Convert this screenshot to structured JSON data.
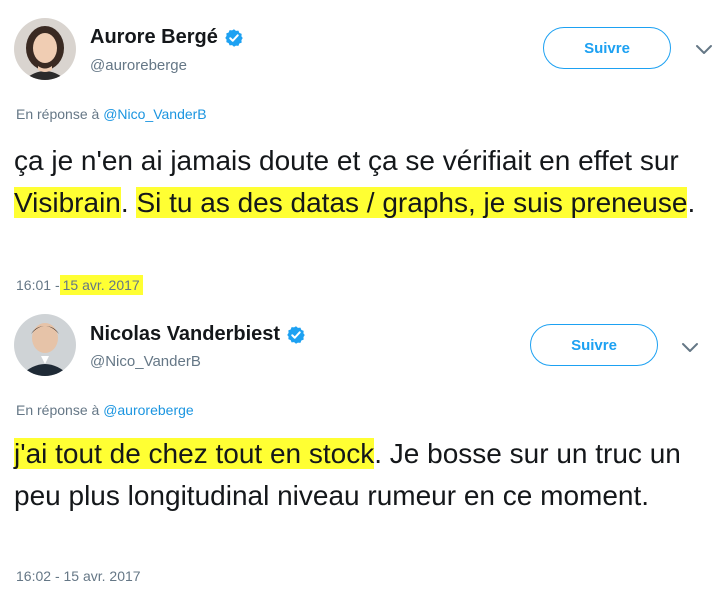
{
  "tweets": [
    {
      "author_name": "Aurore Bergé",
      "handle": "@auroreberge",
      "follow_label": "Suivre",
      "reply_prefix": "En réponse à",
      "reply_to": "@Nico_VanderB",
      "text_segments": [
        {
          "text": "ça je n'en ai jamais doute et ça se vérifiait en effet sur ",
          "highlight": false
        },
        {
          "text": "Visibrain",
          "highlight": true
        },
        {
          "text": ". ",
          "highlight": false
        },
        {
          "text": "Si tu as des datas / graphs, je suis preneuse",
          "highlight": true
        },
        {
          "text": ".",
          "highlight": false
        }
      ],
      "time": "16:01",
      "separator": "-",
      "date": "15 avr. 2017",
      "date_highlighted": true
    },
    {
      "author_name": "Nicolas Vanderbiest",
      "handle": "@Nico_VanderB",
      "follow_label": "Suivre",
      "reply_prefix": "En réponse à",
      "reply_to": "@auroreberge",
      "text_segments": [
        {
          "text": "j'ai tout de chez tout en stock",
          "highlight": true
        },
        {
          "text": ". Je bosse sur un truc un peu plus longitudinal niveau rumeur en ce moment.",
          "highlight": false
        }
      ],
      "time": "16:02",
      "separator": "-",
      "date": "15 avr. 2017",
      "date_highlighted": false
    }
  ],
  "colors": {
    "accent": "#1da1f2",
    "link": "#1b95e0",
    "muted": "#657786",
    "text": "#14171a",
    "highlight": "#ffff33"
  },
  "icons": {
    "verified": "verified-badge-icon",
    "caret": "chevron-down-icon"
  }
}
